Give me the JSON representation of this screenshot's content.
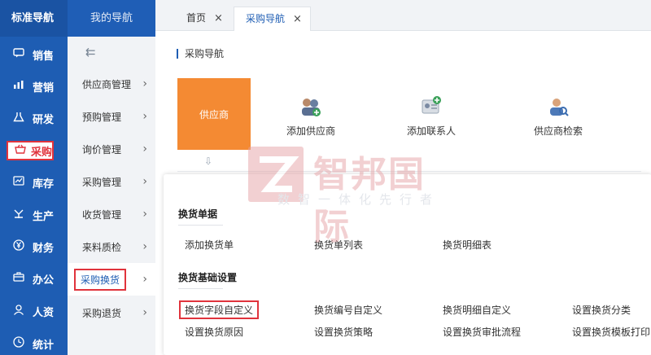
{
  "leftnav": {
    "brand": "标准导航",
    "items": [
      {
        "label": "销售",
        "icon": "chat-icon"
      },
      {
        "label": "营销",
        "icon": "bar-chart-icon"
      },
      {
        "label": "研发",
        "icon": "flask-icon"
      },
      {
        "label": "采购",
        "icon": "basket-icon"
      },
      {
        "label": "库存",
        "icon": "chart-box-icon"
      },
      {
        "label": "生产",
        "icon": "gear-icon"
      },
      {
        "label": "财务",
        "icon": "yen-icon"
      },
      {
        "label": "办公",
        "icon": "briefcase-icon"
      },
      {
        "label": "人资",
        "icon": "user-icon"
      },
      {
        "label": "统计",
        "icon": "clock-icon"
      }
    ],
    "active_index": 3
  },
  "subnav": {
    "title": "我的导航",
    "items": [
      {
        "label": "供应商管理"
      },
      {
        "label": "预购管理"
      },
      {
        "label": "询价管理"
      },
      {
        "label": "采购管理"
      },
      {
        "label": "收货管理"
      },
      {
        "label": "来料质检"
      },
      {
        "label": "采购换货"
      },
      {
        "label": "采购退货"
      }
    ],
    "selected_index": 6
  },
  "tabs": [
    {
      "label": "首页",
      "close": "×"
    },
    {
      "label": "采购导航",
      "close": "×"
    }
  ],
  "main": {
    "title": "采购导航",
    "supplier_label": "供应商",
    "actions": [
      {
        "label": "添加供应商",
        "icon": "add-supplier-icon"
      },
      {
        "label": "添加联系人",
        "icon": "add-contact-icon"
      },
      {
        "label": "供应商检索",
        "icon": "search-supplier-icon"
      }
    ]
  },
  "panel": {
    "group1_title": "换货单据",
    "group1_links": [
      "添加换货单",
      "换货单列表",
      "换货明细表"
    ],
    "group2_title": "换货基础设置",
    "group2_row1": [
      "换货字段自定义",
      "换货编号自定义",
      "换货明细自定义",
      "设置换货分类"
    ],
    "group2_row2": [
      "设置换货原因",
      "设置换货策略",
      "设置换货审批流程",
      "设置换货模板打印"
    ]
  },
  "watermark": {
    "name": "智邦国际",
    "slogan": "数智一体化先行者"
  },
  "colors": {
    "nav_blue": "#1e5db3",
    "highlight_red": "#e0333c",
    "supplier_orange": "#f48a33"
  }
}
